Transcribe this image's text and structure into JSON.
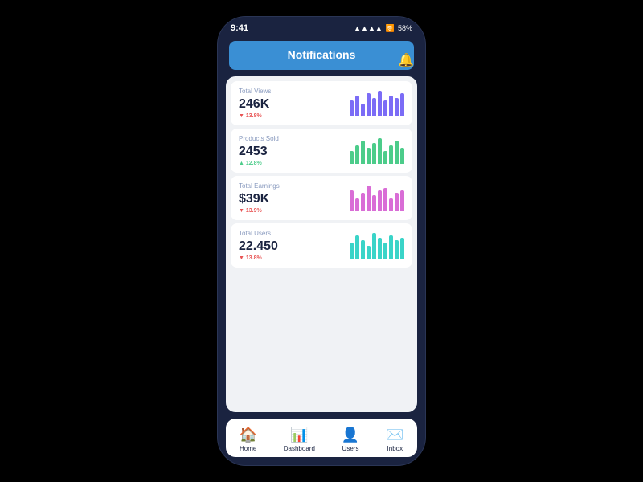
{
  "statusBar": {
    "time": "9:41",
    "battery": "58%",
    "signal": "●●●●",
    "wifi": "wifi"
  },
  "header": {
    "title": "Notifications"
  },
  "bell": "🔔",
  "cards": [
    {
      "label": "Total Views",
      "value": "246K",
      "change": "▼ 13.8%",
      "changeType": "down",
      "chartColor": "#7b6cf6",
      "bars": [
        60,
        80,
        50,
        90,
        70,
        100,
        60,
        80,
        70,
        90
      ]
    },
    {
      "label": "Products Sold",
      "value": "2453",
      "change": "▲ 12.8%",
      "changeType": "up",
      "chartColor": "#4ccc8a",
      "bars": [
        50,
        70,
        90,
        60,
        80,
        100,
        50,
        70,
        90,
        60
      ]
    },
    {
      "label": "Total Earnings",
      "value": "$39K",
      "change": "▼ 13.9%",
      "changeType": "down",
      "chartColor": "#d96dd6",
      "bars": [
        80,
        50,
        70,
        100,
        60,
        80,
        90,
        50,
        70,
        80
      ]
    },
    {
      "label": "Total Users",
      "value": "22.450",
      "change": "▼ 13.8%",
      "changeType": "down",
      "chartColor": "#3ad4c8",
      "bars": [
        60,
        90,
        70,
        50,
        100,
        80,
        60,
        90,
        70,
        80
      ]
    }
  ],
  "nav": [
    {
      "label": "Home",
      "icon": "🏠",
      "active": true
    },
    {
      "label": "Dashboard",
      "icon": "📊",
      "active": false
    },
    {
      "label": "Users",
      "icon": "👤",
      "active": false
    },
    {
      "label": "Inbox",
      "icon": "✉️",
      "active": false
    }
  ]
}
